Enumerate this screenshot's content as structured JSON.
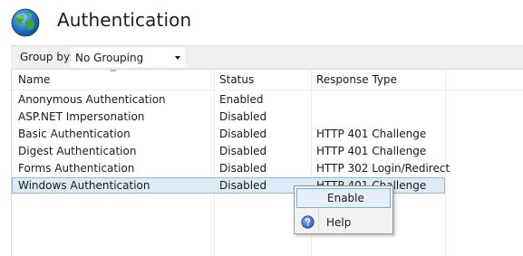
{
  "header": {
    "title": "Authentication",
    "icon": "globe-icon"
  },
  "toolbar": {
    "group_label": "Group by:",
    "group_value": "No Grouping"
  },
  "list": {
    "columns": [
      "Name",
      "Status",
      "Response Type"
    ],
    "rows": [
      {
        "name": "Anonymous Authentication",
        "status": "Enabled",
        "response": ""
      },
      {
        "name": "ASP.NET Impersonation",
        "status": "Disabled",
        "response": ""
      },
      {
        "name": "Basic Authentication",
        "status": "Disabled",
        "response": "HTTP 401 Challenge"
      },
      {
        "name": "Digest Authentication",
        "status": "Disabled",
        "response": "HTTP 401 Challenge"
      },
      {
        "name": "Forms Authentication",
        "status": "Disabled",
        "response": "HTTP 302 Login/Redirect"
      },
      {
        "name": "Windows Authentication",
        "status": "Disabled",
        "response": "HTTP 401 Challenge"
      }
    ],
    "selected_index": 5
  },
  "context_menu": {
    "items": [
      {
        "label": "Enable",
        "icon": ""
      },
      {
        "label": "Help",
        "icon": "help-icon"
      }
    ]
  },
  "colors": {
    "selection_bg": "#dfeaf7",
    "selection_border": "#93b7df",
    "menu_highlight": "#e5eff9",
    "menu_highlight_border": "#7aaee0"
  }
}
